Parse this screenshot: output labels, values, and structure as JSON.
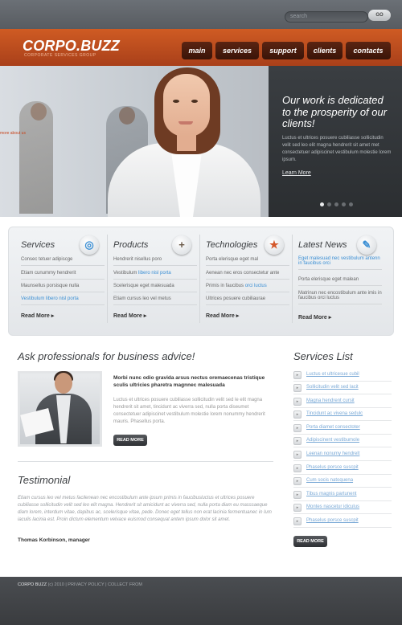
{
  "search": {
    "placeholder": "search",
    "go_label": "GO"
  },
  "brand": {
    "logo": "CORPO.BUZZ",
    "tagline": "CORPORATE SERVICES GROUP"
  },
  "nav": [
    {
      "label": "main"
    },
    {
      "label": "services"
    },
    {
      "label": "support"
    },
    {
      "label": "clients"
    },
    {
      "label": "contacts"
    }
  ],
  "hero": {
    "side_label": "more about us",
    "title": "Our work is dedicated to the prosperity of our clients!",
    "text": "Luctus et ultrices posuere cubiliasse sollicitudin velit sed leo elit magna hendrerit sit amet met consectetuer adipiscinet vestibulum molestie lorem ipsum.",
    "link": "Learn More",
    "slides": 5,
    "active_slide": 1
  },
  "features": [
    {
      "title": "Services",
      "icon": "globe-icon",
      "items": [
        {
          "text": "Consec tetuer adipiscge"
        },
        {
          "text": "Etiam cunummy hendrerit"
        },
        {
          "text": "Maunsellus porsisque nulla"
        },
        {
          "pre": "",
          "hl": "Vestibulum libero nisl porta",
          "post": ""
        }
      ],
      "more": "Read More"
    },
    {
      "title": "Products",
      "icon": "plus-icon",
      "items": [
        {
          "text": "Hendrerit nisellus poro"
        },
        {
          "pre": "Vestibulum ",
          "hl": "libero nisl porta",
          "post": ""
        },
        {
          "text": "Scelerisque eget malesuada"
        },
        {
          "text": "Etiam cursus leo vel metus"
        }
      ],
      "more": "Read More"
    },
    {
      "title": "Technologies",
      "icon": "star-icon",
      "items": [
        {
          "text": "Porta elerisque eget mal"
        },
        {
          "text": "Aenean nec eros consectetur ante"
        },
        {
          "pre": "Primis in faucibus ",
          "hl": "orci luctus",
          "post": ""
        },
        {
          "text": "Ultrices posuere cubiliaurae"
        }
      ],
      "more": "Read More"
    },
    {
      "title": "Latest News",
      "icon": "pen-icon",
      "items": [
        {
          "pre": "",
          "hl": "Eget malesuad nec vestibulum antenn in faucibus orci",
          "post": ""
        },
        {
          "text": "Porta elerisque eget malean"
        },
        {
          "text": "Matrinun nec encostibulum ante imis in faucibus orci luctus"
        }
      ],
      "more": "Read More"
    }
  ],
  "ask": {
    "title": "Ask professionals for business advice!",
    "bold_text": "Morbi nunc odio gravida arsus nectus oremaecenas tristique sculis ultricies pharetra magnnec malesuada",
    "text": "Luctus et ultrices posuere cubiliasse sollicitudin velit sed le elit magna hendrerit sit amet, tincidunt ac viverra sed, nulla porta diseumet consectetuer adipiscinet vestibulum molestie lorem nonummy hendrerit mauris. Phasellus porta.",
    "button": "READ MORE"
  },
  "testimonial": {
    "title": "Testimonial",
    "text": "Etiam cursus leo vel metus facilenean nec encostibulum ante ipsum primis in faucibusluctus et ultrices posuere cubiliasse sollicitudin velit sed leo elit magna. Hendrerit sit amicidunt ac viverra sed, nulla porta diam eu masssaeque diam lorem, interdum vitae, dapibus ac, scelerisque vitae, pede. Donec eget tellus non erat lacinia fermentuanec in lum iaculis lacinia est. Proin dictum elementum velvace euismod consequat antem ipsum dolor sit amet.",
    "author": "Thomas Korbinson, manager"
  },
  "services_list": {
    "title": "Services List",
    "items": [
      "Luctus et ultricesue cubil",
      "Sollicitudin velit sed lacit",
      "Magna hendrent cursit",
      "Tincidunt ac vivena sedulc",
      "Porta diamet consectoter",
      "Adipiscinent vestibumole",
      "Leenan nonumy hendrelt",
      "Phaselus porsce suscpit",
      "Cum socis natoquena",
      "Tibus magnis partunent",
      "Montes nascetur idiculus",
      "Phaselus porsce suscpit"
    ],
    "button": "READ MORE"
  },
  "footer": {
    "brand": "CORPO BUZZ",
    "year": "(c) 2010",
    "privacy": "PRIVACY POLICY",
    "collect": "COLLECT FROM"
  }
}
